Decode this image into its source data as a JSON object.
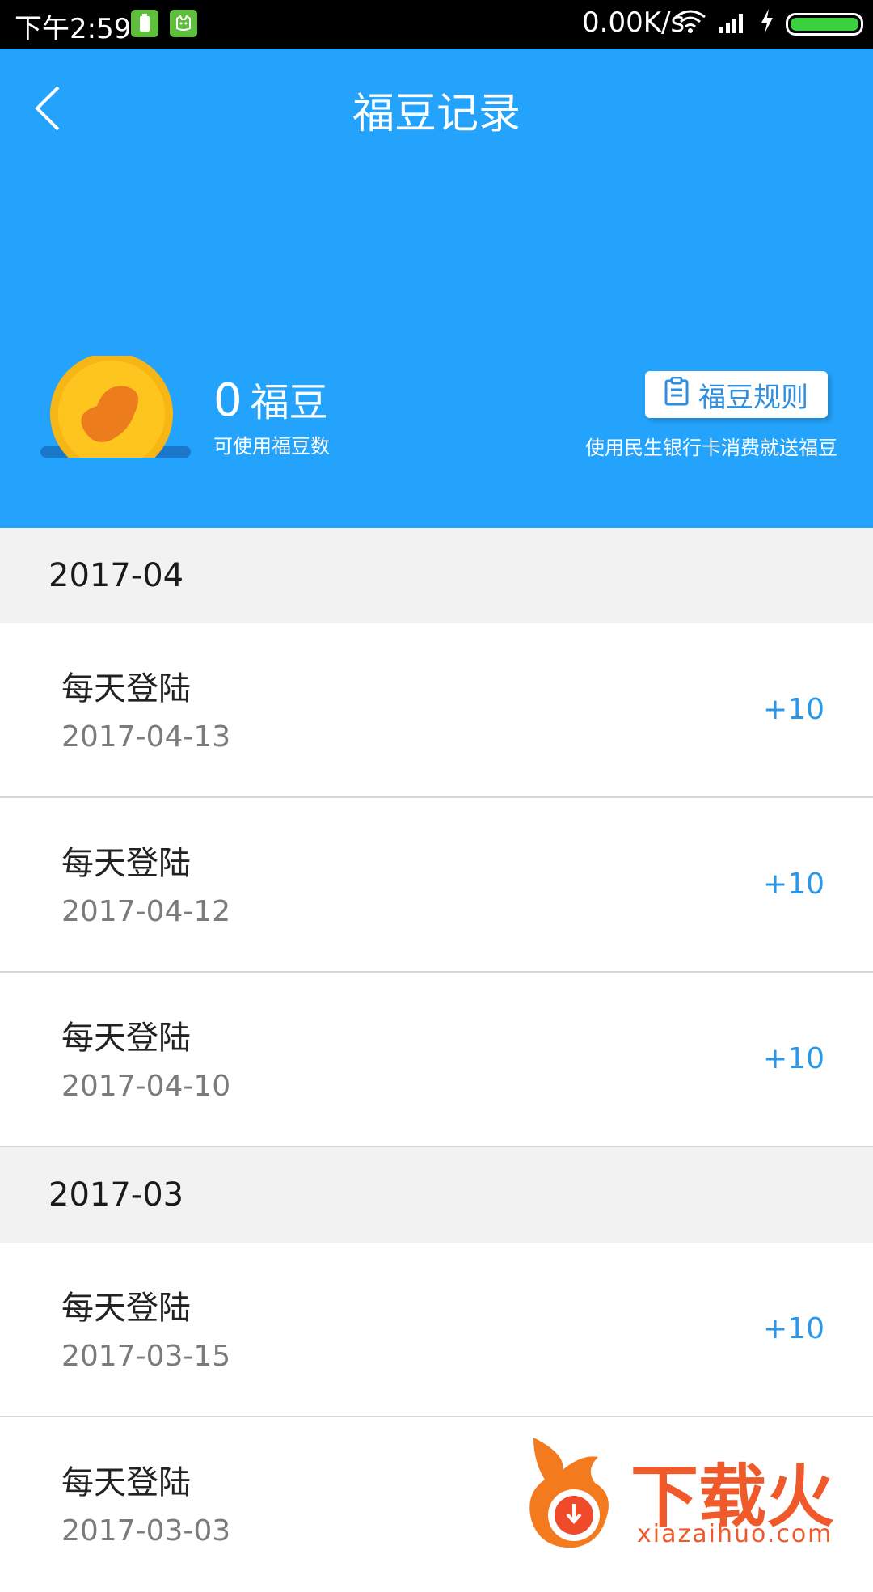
{
  "status_bar": {
    "time": "下午2:59",
    "network_speed": "0.00K/s"
  },
  "header": {
    "title": "福豆记录",
    "balance_value": "0",
    "balance_unit": "福豆",
    "balance_label": "可使用福豆数",
    "rules_button": "福豆规则",
    "rules_subtext": "使用民生银行卡消费就送福豆"
  },
  "colors": {
    "header_bg": "#24a3fc",
    "points": "#2b97e9",
    "month_bg": "#f2f2f2"
  },
  "records": [
    {
      "month": "2017-04",
      "items": [
        {
          "name": "每天登陆",
          "date": "2017-04-13",
          "points": "+10"
        },
        {
          "name": "每天登陆",
          "date": "2017-04-12",
          "points": "+10"
        },
        {
          "name": "每天登陆",
          "date": "2017-04-10",
          "points": "+10"
        }
      ]
    },
    {
      "month": "2017-03",
      "items": [
        {
          "name": "每天登陆",
          "date": "2017-03-15",
          "points": "+10"
        },
        {
          "name": "每天登陆",
          "date": "2017-03-03",
          "points": ""
        }
      ]
    }
  ],
  "watermark": {
    "brand": "下载火",
    "domain": "xiazaihuo.com"
  }
}
